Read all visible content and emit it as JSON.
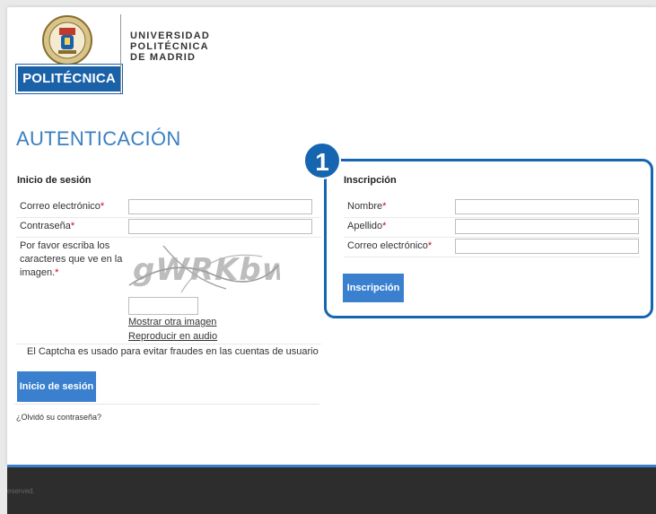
{
  "logo": {
    "box_label": "POLITÉCNICA",
    "line1": "UNIVERSIDAD",
    "line2": "POLITÉCNICA",
    "line3": "DE MADRID"
  },
  "page": {
    "title": "AUTENTICACIÓN"
  },
  "login": {
    "heading": "Inicio de sesión",
    "email_label": "Correo electrónico",
    "password_label": "Contraseña",
    "required_mark": "*",
    "captcha_label": "Por favor escriba los caracteres que ve en la imagen.",
    "captcha_text": "gWRKbw",
    "show_other_image": "Mostrar otra imagen",
    "play_audio": "Reproducir en audio",
    "captcha_note": "El Captcha es usado para evitar fraudes en las cuentas de usuario",
    "submit_label": "Inicio de sesión",
    "forgot_password": "¿Olvidó su contraseña?"
  },
  "register": {
    "callout_number": "1",
    "heading": "Inscripción",
    "first_name_label": "Nombre",
    "last_name_label": "Apellido",
    "email_label": "Correo electrónico",
    "submit_label": "Inscripción"
  },
  "footer": {
    "text": "eserved."
  },
  "colors": {
    "accent": "#3a80cf",
    "callout": "#1565b0",
    "title": "#3a7fc3",
    "required": "#d0021b",
    "logo_blue": "#1b61a8"
  }
}
